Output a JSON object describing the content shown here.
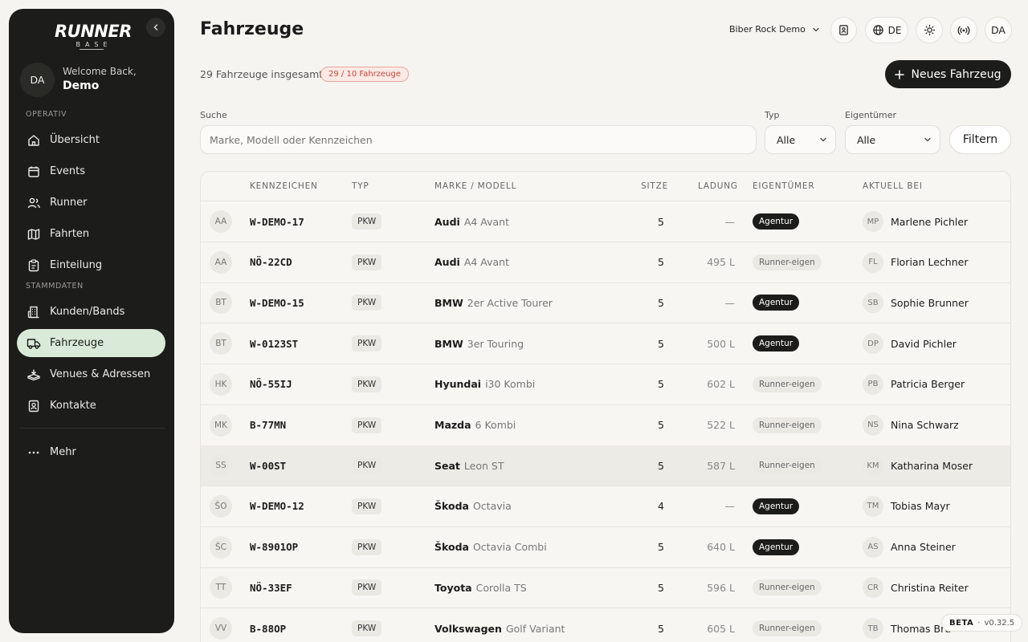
{
  "sidebar": {
    "logo_main": "RUNNER",
    "logo_sub": "BASE",
    "user_initials": "DA",
    "welcome": "Welcome Back,",
    "user_name": "Demo",
    "section_operativ": "OPERATIV",
    "section_stammdaten": "STAMMDATEN",
    "items": [
      {
        "label": "Übersicht",
        "icon": "home-icon"
      },
      {
        "label": "Events",
        "icon": "calendar-icon"
      },
      {
        "label": "Runner",
        "icon": "users-icon"
      },
      {
        "label": "Fahrten",
        "icon": "map-icon"
      },
      {
        "label": "Einteilung",
        "icon": "clipboard-icon"
      },
      {
        "label": "Kunden/Bands",
        "icon": "building-icon"
      },
      {
        "label": "Fahrzeuge",
        "icon": "truck-icon",
        "active": true
      },
      {
        "label": "Venues & Adressen",
        "icon": "venue-icon"
      },
      {
        "label": "Kontakte",
        "icon": "contact-icon"
      },
      {
        "label": "Mehr",
        "icon": "more-icon"
      }
    ]
  },
  "header": {
    "title": "Fahrzeuge",
    "org": "Biber Rock Demo",
    "language": "DE",
    "user_initials": "DA"
  },
  "summary": {
    "total": "29 Fahrzeuge insgesamt",
    "quota": "29 / 10 Fahrzeuge",
    "new_button": "Neues Fahrzeug"
  },
  "filters": {
    "search_label": "Suche",
    "search_placeholder": "Marke, Modell oder Kennzeichen",
    "type_label": "Typ",
    "type_value": "Alle",
    "owner_label": "Eigentümer",
    "owner_value": "Alle",
    "filter_button": "Filtern"
  },
  "table": {
    "columns": {
      "plate": "KENNZEICHEN",
      "type": "TYP",
      "model": "MARKE / MODELL",
      "seats": "SITZE",
      "cargo": "LADUNG",
      "owner": "EIGENTÜMER",
      "current": "AKTUELL BEI"
    },
    "rows": [
      {
        "initials": "AA",
        "plate": "W-DEMO-17",
        "type": "PKW",
        "brand": "Audi",
        "model": "A4 Avant",
        "seats": "5",
        "cargo": "—",
        "owner": "Agentur",
        "owner_kind": "agency",
        "person_initials": "MP",
        "person": "Marlene Pichler"
      },
      {
        "initials": "AA",
        "plate": "NÖ-22CD",
        "type": "PKW",
        "brand": "Audi",
        "model": "A4 Avant",
        "seats": "5",
        "cargo": "495 L",
        "owner": "Runner-eigen",
        "owner_kind": "runner",
        "person_initials": "FL",
        "person": "Florian Lechner"
      },
      {
        "initials": "BT",
        "plate": "W-DEMO-15",
        "type": "PKW",
        "brand": "BMW",
        "model": "2er Active Tourer",
        "seats": "5",
        "cargo": "—",
        "owner": "Agentur",
        "owner_kind": "agency",
        "person_initials": "SB",
        "person": "Sophie Brunner"
      },
      {
        "initials": "BT",
        "plate": "W-0123ST",
        "type": "PKW",
        "brand": "BMW",
        "model": "3er Touring",
        "seats": "5",
        "cargo": "500 L",
        "owner": "Agentur",
        "owner_kind": "agency",
        "person_initials": "DP",
        "person": "David Pichler"
      },
      {
        "initials": "HK",
        "plate": "NÖ-55IJ",
        "type": "PKW",
        "brand": "Hyundai",
        "model": "i30 Kombi",
        "seats": "5",
        "cargo": "602 L",
        "owner": "Runner-eigen",
        "owner_kind": "runner",
        "person_initials": "PB",
        "person": "Patricia Berger"
      },
      {
        "initials": "MK",
        "plate": "B-77MN",
        "type": "PKW",
        "brand": "Mazda",
        "model": "6 Kombi",
        "seats": "5",
        "cargo": "522 L",
        "owner": "Runner-eigen",
        "owner_kind": "runner",
        "person_initials": "NS",
        "person": "Nina Schwarz"
      },
      {
        "initials": "SS",
        "plate": "W-00ST",
        "type": "PKW",
        "brand": "Seat",
        "model": "Leon ST",
        "seats": "5",
        "cargo": "587 L",
        "owner": "Runner-eigen",
        "owner_kind": "runner",
        "person_initials": "KM",
        "person": "Katharina Moser",
        "highlight": true
      },
      {
        "initials": "ŠO",
        "plate": "W-DEMO-12",
        "type": "PKW",
        "brand": "Škoda",
        "model": "Octavia",
        "seats": "4",
        "cargo": "—",
        "owner": "Agentur",
        "owner_kind": "agency",
        "person_initials": "TM",
        "person": "Tobias Mayr"
      },
      {
        "initials": "ŠC",
        "plate": "W-8901OP",
        "type": "PKW",
        "brand": "Škoda",
        "model": "Octavia Combi",
        "seats": "5",
        "cargo": "640 L",
        "owner": "Agentur",
        "owner_kind": "agency",
        "person_initials": "AS",
        "person": "Anna Steiner"
      },
      {
        "initials": "TT",
        "plate": "NÖ-33EF",
        "type": "PKW",
        "brand": "Toyota",
        "model": "Corolla TS",
        "seats": "5",
        "cargo": "596 L",
        "owner": "Runner-eigen",
        "owner_kind": "runner",
        "person_initials": "CR",
        "person": "Christina Reiter"
      },
      {
        "initials": "VV",
        "plate": "B-88OP",
        "type": "PKW",
        "brand": "Volkswagen",
        "model": "Golf Variant",
        "seats": "5",
        "cargo": "605 L",
        "owner": "Runner-eigen",
        "owner_kind": "runner",
        "person_initials": "TB",
        "person": "Thomas Bru"
      }
    ]
  },
  "version": {
    "tag": "BETA",
    "sep": "·",
    "number": "v0.32.5"
  }
}
